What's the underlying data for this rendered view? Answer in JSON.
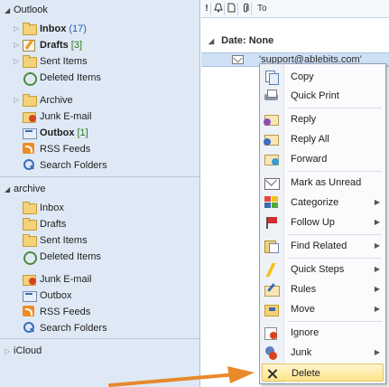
{
  "nav": {
    "accounts": [
      {
        "name": "Outlook",
        "folders": [
          {
            "label": "Inbox",
            "count": "(17)",
            "bold": true,
            "icon": "folder-icon"
          },
          {
            "label": "Drafts",
            "count": "[3]",
            "bold": true,
            "icon": "drafts-icon"
          },
          {
            "label": "Sent Items",
            "count": "",
            "bold": false,
            "icon": "folder-icon"
          },
          {
            "label": "Deleted Items",
            "count": "",
            "bold": false,
            "icon": "deleted-items-icon"
          },
          {
            "label": "Archive",
            "count": "",
            "bold": false,
            "icon": "folder-icon"
          },
          {
            "label": "Junk E-mail",
            "count": "",
            "bold": false,
            "icon": "junk-icon"
          },
          {
            "label": "Outbox",
            "count": "[1]",
            "bold": true,
            "icon": "outbox-icon"
          },
          {
            "label": "RSS Feeds",
            "count": "",
            "bold": false,
            "icon": "rss-icon"
          },
          {
            "label": "Search Folders",
            "count": "",
            "bold": false,
            "icon": "search-folder-icon"
          }
        ]
      },
      {
        "name": "archive",
        "folders": [
          {
            "label": "Inbox",
            "icon": "folder-icon"
          },
          {
            "label": "Drafts",
            "icon": "folder-icon"
          },
          {
            "label": "Sent Items",
            "icon": "folder-icon"
          },
          {
            "label": "Deleted Items",
            "icon": "deleted-items-icon"
          },
          {
            "label": "Junk E-mail",
            "icon": "junk-icon"
          },
          {
            "label": "Outbox",
            "icon": "outbox-icon"
          },
          {
            "label": "RSS Feeds",
            "icon": "rss-icon"
          },
          {
            "label": "Search Folders",
            "icon": "search-folder-icon"
          }
        ]
      },
      {
        "name": "iCloud",
        "folders": []
      }
    ]
  },
  "list": {
    "columns": [
      "!",
      "bell-icon",
      "page-icon",
      "paperclip-icon",
      "To"
    ],
    "column_labels": {
      "importance": "!",
      "to": "To"
    },
    "group_label": "Date: None",
    "message": {
      "to": "'support@ablebits.com'"
    }
  },
  "menu": {
    "items": [
      {
        "label": "Copy",
        "icon": "copy-icon",
        "submenu": false
      },
      {
        "label": "Quick Print",
        "icon": "print-icon",
        "submenu": false
      },
      {
        "label": "Reply",
        "icon": "reply-icon",
        "submenu": false
      },
      {
        "label": "Reply All",
        "icon": "reply-all-icon",
        "submenu": false
      },
      {
        "label": "Forward",
        "icon": "forward-icon",
        "submenu": false
      },
      {
        "label": "Mark as Unread",
        "icon": "mark-unread-icon",
        "submenu": false
      },
      {
        "label": "Categorize",
        "icon": "categorize-icon",
        "submenu": true
      },
      {
        "label": "Follow Up",
        "icon": "flag-icon",
        "submenu": true
      },
      {
        "label": "Find Related",
        "icon": "find-related-icon",
        "submenu": true
      },
      {
        "label": "Quick Steps",
        "icon": "quick-steps-icon",
        "submenu": true
      },
      {
        "label": "Rules",
        "icon": "rules-icon",
        "submenu": true
      },
      {
        "label": "Move",
        "icon": "move-icon",
        "submenu": true
      },
      {
        "label": "Ignore",
        "icon": "ignore-icon",
        "submenu": false
      },
      {
        "label": "Junk",
        "icon": "junk-menu-icon",
        "submenu": true
      },
      {
        "label": "Delete",
        "icon": "delete-icon",
        "submenu": false,
        "highlighted": true
      }
    ]
  },
  "colors": {
    "nav_bg": "#dfe9f5",
    "row_selected": "#cfe0f4",
    "menu_highlight": "#fde48b",
    "arrow": "#e8892b",
    "count_blue": "#1f5fb5",
    "count_green": "#2a7a1a"
  }
}
